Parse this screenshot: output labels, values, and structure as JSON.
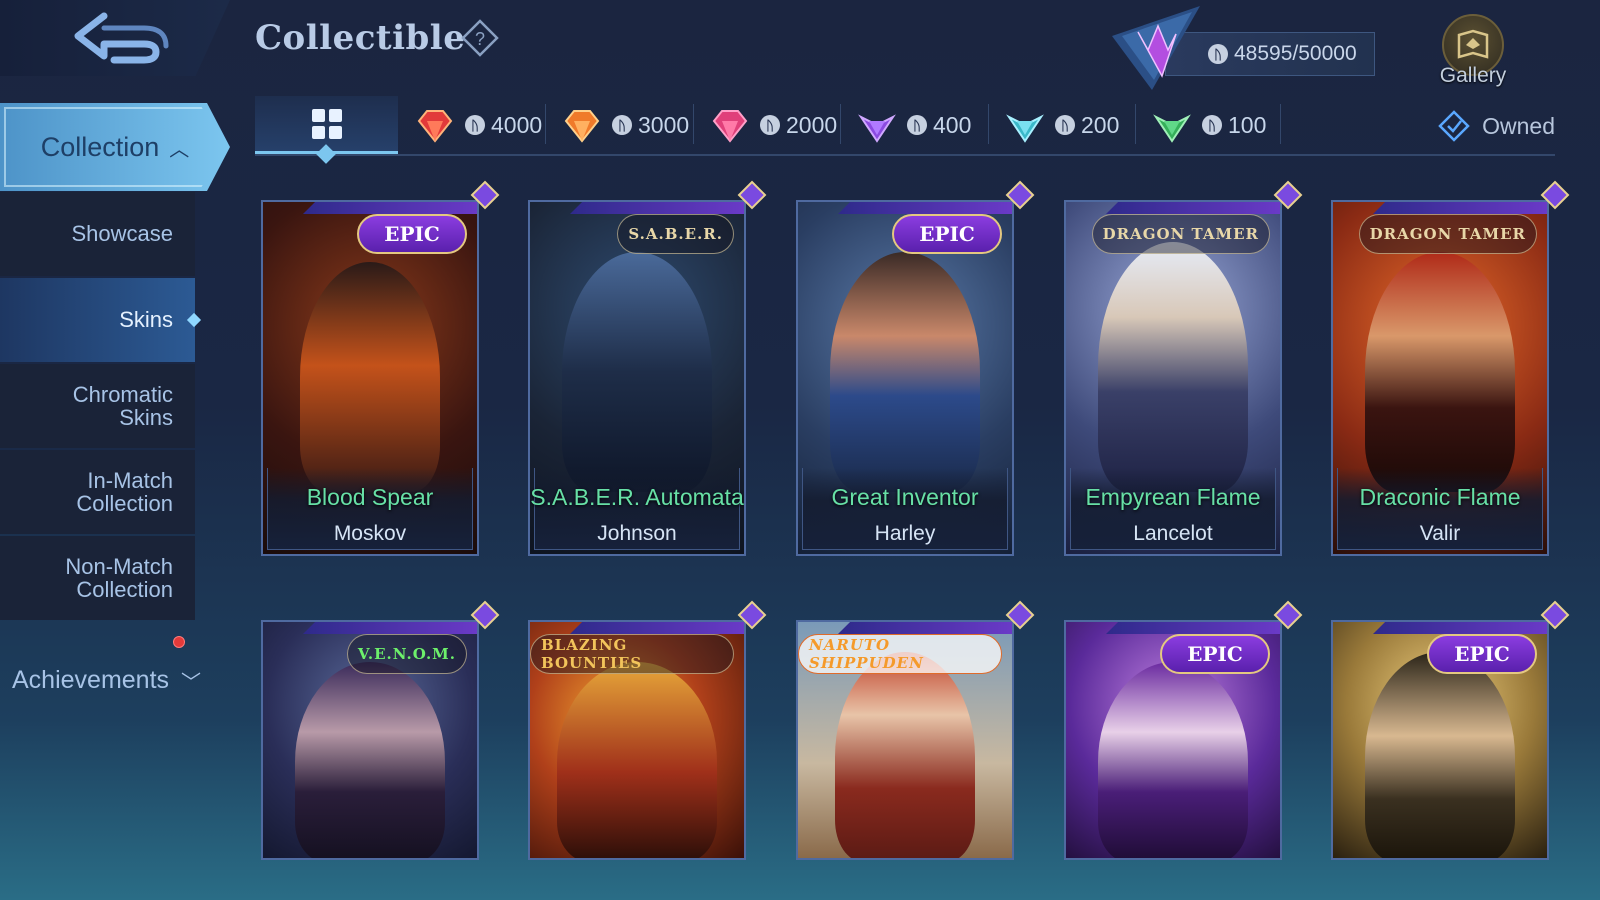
{
  "header": {
    "title": "Collectible",
    "currency": "48595/50000",
    "gallery_label": "Gallery"
  },
  "sidebar": {
    "collection_label": "Collection",
    "items": [
      {
        "label": "Showcase"
      },
      {
        "label": "Skins"
      },
      {
        "label": "Chromatic Skins"
      },
      {
        "label": "In-Match Collection"
      },
      {
        "label": "Non-Match Collection"
      }
    ],
    "achievements_label": "Achievements"
  },
  "filters": {
    "tabs": [
      {
        "price": "4000",
        "gem": "red-gem-icon",
        "color": "#e23a3a"
      },
      {
        "price": "3000",
        "gem": "orange-gem-icon",
        "color": "#f07a2a"
      },
      {
        "price": "2000",
        "gem": "pink-gem-icon",
        "color": "#e0407a"
      },
      {
        "price": "400",
        "gem": "purple-gem-icon",
        "color": "#8b4ae0"
      },
      {
        "price": "200",
        "gem": "teal-gem-icon",
        "color": "#3ab8c8"
      },
      {
        "price": "100",
        "gem": "green-gem-icon",
        "color": "#35b05a"
      }
    ],
    "owned_label": "Owned"
  },
  "cards": [
    {
      "skin": "Blood Spear",
      "hero": "Moskov",
      "badge": "EPIC",
      "badge_type": "epic"
    },
    {
      "skin": "S.A.B.E.R. Automata",
      "hero": "Johnson",
      "badge": "S.A.B.E.R.",
      "badge_type": "series"
    },
    {
      "skin": "Great Inventor",
      "hero": "Harley",
      "badge": "EPIC",
      "badge_type": "epic"
    },
    {
      "skin": "Empyrean Flame",
      "hero": "Lancelot",
      "badge": "DRAGON TAMER",
      "badge_type": "series"
    },
    {
      "skin": "Draconic Flame",
      "hero": "Valir",
      "badge": "DRAGON TAMER",
      "badge_type": "series"
    },
    {
      "skin": "",
      "hero": "",
      "badge": "V.E.N.O.M.",
      "badge_type": "venom"
    },
    {
      "skin": "",
      "hero": "",
      "badge": "BLAZING BOUNTIES",
      "badge_type": "blazing"
    },
    {
      "skin": "",
      "hero": "",
      "badge": "NARUTO SHIPPUDEN",
      "badge_type": "naruto"
    },
    {
      "skin": "",
      "hero": "",
      "badge": "EPIC",
      "badge_type": "epic"
    },
    {
      "skin": "",
      "hero": "",
      "badge": "EPIC",
      "badge_type": "epic"
    }
  ],
  "colors": {
    "accent": "#7cc6ef",
    "skin_name": "#67e0a6",
    "epic_badge": "#8b3de0"
  }
}
